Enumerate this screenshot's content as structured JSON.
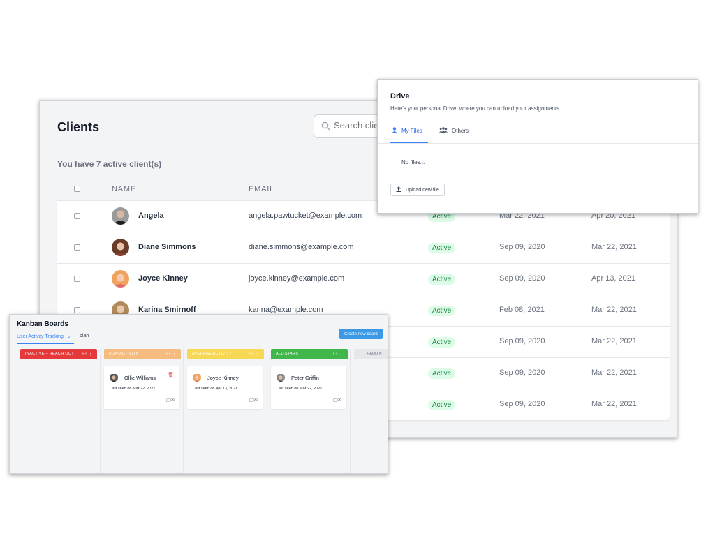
{
  "clients": {
    "title": "Clients",
    "search_placeholder": "Search clients",
    "active_count": "You have 7 active client(s)",
    "columns": [
      "NAME",
      "EMAIL"
    ],
    "rows": [
      {
        "name": "Angela",
        "email": "angela.pawtucket@example.com",
        "status": "Active",
        "date1": "Mar 22, 2021",
        "date2": "Apr 20, 2021"
      },
      {
        "name": "Diane Simmons",
        "email": "diane.simmons@example.com",
        "status": "Active",
        "date1": "Sep 09, 2020",
        "date2": "Mar 22, 2021"
      },
      {
        "name": "Joyce Kinney",
        "email": "joyce.kinney@example.com",
        "status": "Active",
        "date1": "Sep 09, 2020",
        "date2": "Apr 13, 2021"
      },
      {
        "name": "Karina Smirnoff",
        "email": "karina@example.com",
        "status": "Active",
        "date1": "Feb 08, 2021",
        "date2": "Mar 22, 2021"
      },
      {
        "name": "",
        "email": "",
        "status": "Active",
        "date1": "Sep 09, 2020",
        "date2": "Mar 22, 2021"
      },
      {
        "name": "",
        "email": "",
        "status": "Active",
        "date1": "Sep 09, 2020",
        "date2": "Mar 22, 2021"
      },
      {
        "name": "",
        "email": "",
        "status": "Active",
        "date1": "Sep 09, 2020",
        "date2": "Mar 22, 2021"
      }
    ],
    "accent_status_bg": "#dcfce7",
    "accent_status_text": "#15803d"
  },
  "drive": {
    "title": "Drive",
    "subtitle": "Here's your personal Drive, where you can upload your assignments.",
    "tabs": [
      {
        "label": "My Files",
        "icon": "user-icon"
      },
      {
        "label": "Others",
        "icon": "users-icon"
      }
    ],
    "empty_text": "No files...",
    "upload_label": "Upload new file"
  },
  "kanban": {
    "title": "Kanban Boards",
    "tabs": [
      "User Activity Tracking",
      "blah"
    ],
    "create_label": "Create new board",
    "add_label": "+ ADD N",
    "columns": [
      {
        "label": "INACTIVE – REACH OUT",
        "color": "#e5393b"
      },
      {
        "label": "LOW ACTIVITY",
        "color": "#f6bb7e"
      },
      {
        "label": "AVERAGE ACTIVITY",
        "color": "#f6d855"
      },
      {
        "label": "ALL-STARS",
        "color": "#41b64a"
      }
    ],
    "cards": [
      {
        "name": "Ollie Williams",
        "seen": "Last seen on Mar 22, 2021"
      },
      {
        "name": "Joyce Kinney",
        "seen": "Last seen on Apr 13, 2021"
      },
      {
        "name": "Peter Griffin",
        "seen": "Last seen on Mar 22, 2021"
      }
    ]
  }
}
